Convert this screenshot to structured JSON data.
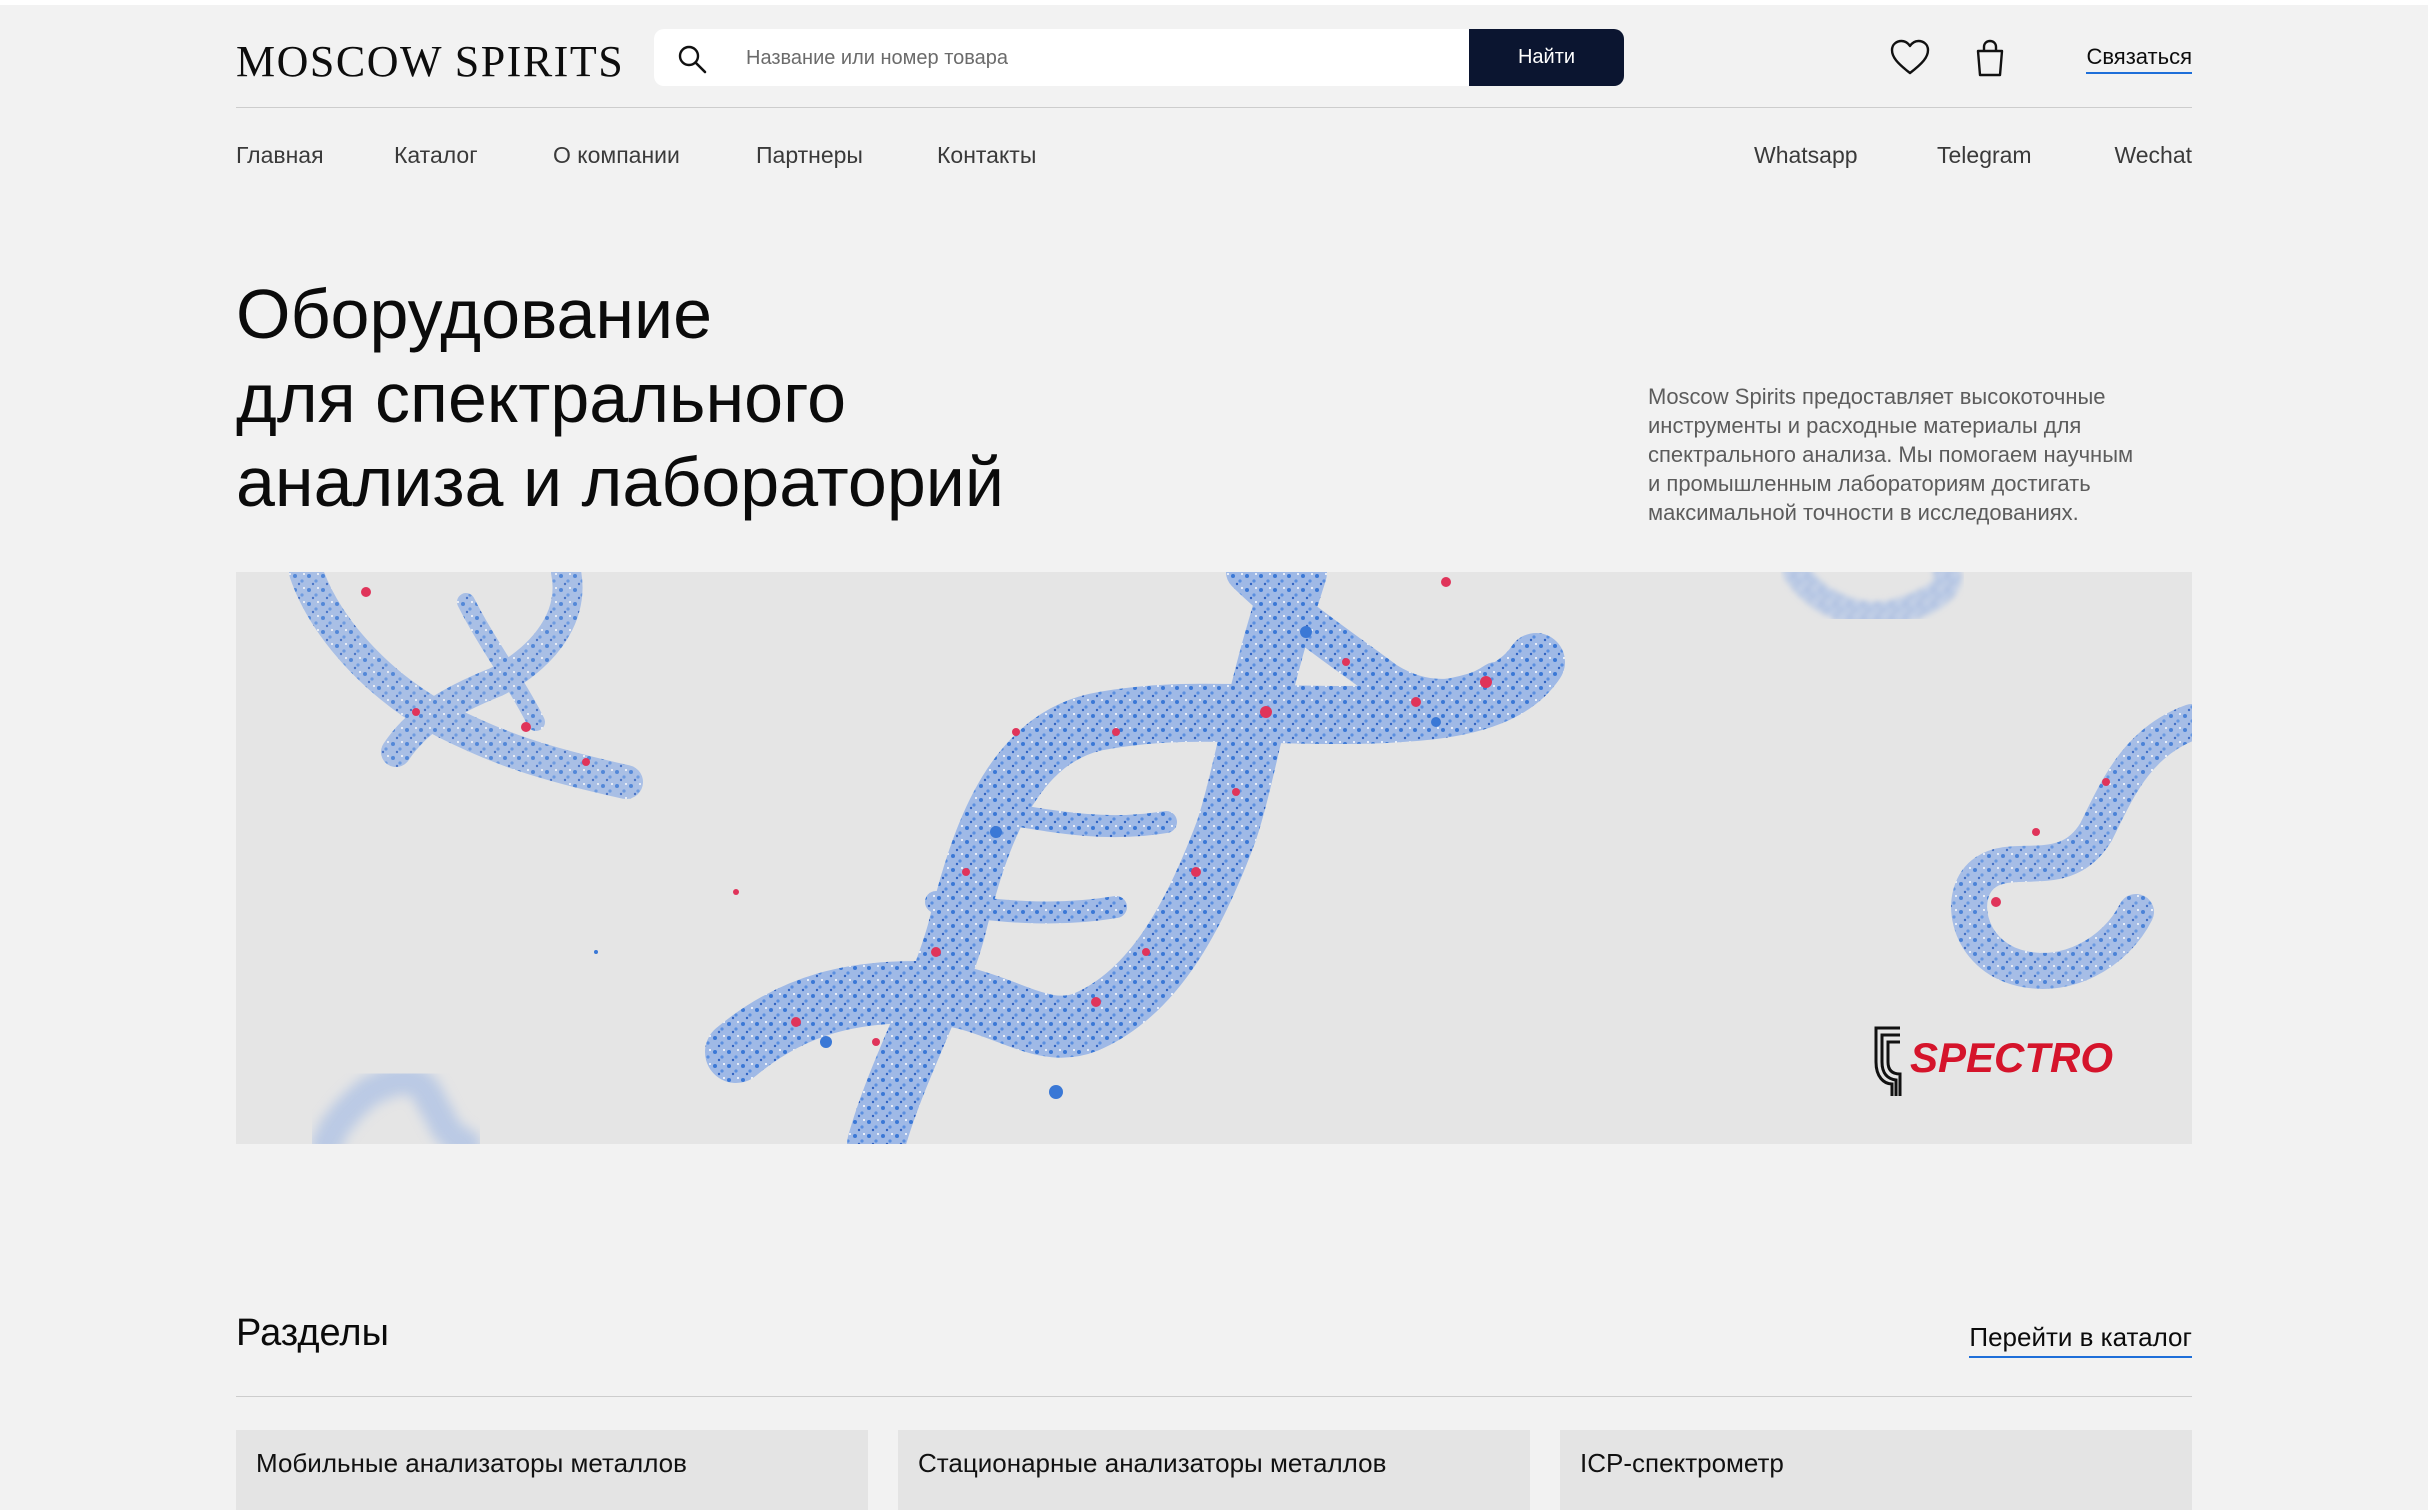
{
  "header": {
    "logo": "MOSCOW SPIRITS",
    "search_placeholder": "Название или номер товара",
    "search_button": "Найти",
    "icons": [
      "search-icon",
      "heart-icon",
      "bag-icon"
    ],
    "contact_label": "Связаться"
  },
  "nav": {
    "items": [
      "Главная",
      "Каталог",
      "О компании",
      "Партнеры",
      "Контакты"
    ],
    "messengers": [
      "Whatsapp",
      "Telegram",
      "Wechat"
    ]
  },
  "hero": {
    "title_lines": [
      "Оборудование",
      "для спектрального",
      "анализа и лабораторий"
    ],
    "description_lines": [
      "Moscow Spirits предоставляет высокоточные",
      "инструменты и расходные материалы для",
      "спектрального анализа. Мы помогаем научным",
      "и промышленным лабораториям достигать",
      "максимальной точности в исследованиях."
    ],
    "banner_logo": "SPECTRO"
  },
  "sections": {
    "title": "Разделы",
    "catalog_link": "Перейти в каталог",
    "cards": [
      "Мобильные анализаторы металлов",
      "Стационарные анализаторы металлов",
      "ICP-спектрометр"
    ]
  },
  "colors": {
    "background": "#f2f2f2",
    "button": "#0b1530",
    "link_underline": "#1e6fd9",
    "dna_blue": "#3a78d6",
    "dna_red": "#e0345a",
    "spectro_red": "#d5142b"
  }
}
